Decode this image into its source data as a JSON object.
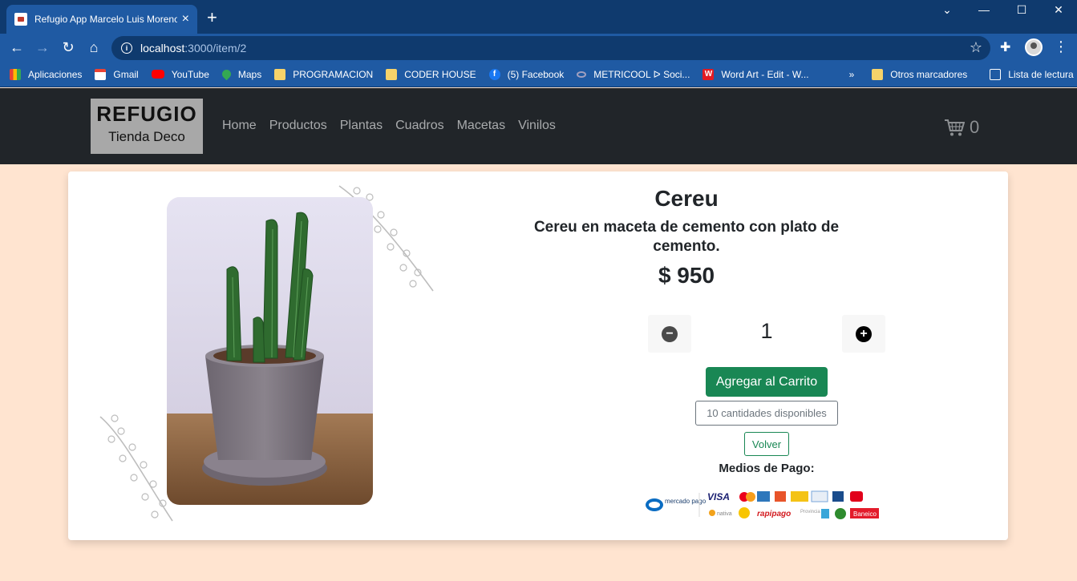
{
  "browser": {
    "tab_title": "Refugio App Marcelo Luis Moreno",
    "url_host": "localhost",
    "url_path": ":3000/item/2",
    "bookmarks": [
      {
        "label": "Aplicaciones",
        "icon": "apps-icon"
      },
      {
        "label": "Gmail",
        "icon": "gmail-icon"
      },
      {
        "label": "YouTube",
        "icon": "youtube-icon"
      },
      {
        "label": "Maps",
        "icon": "maps-icon"
      },
      {
        "label": "PROGRAMACION",
        "icon": "folder-icon"
      },
      {
        "label": "CODER HOUSE",
        "icon": "folder-icon"
      },
      {
        "label": "(5) Facebook",
        "icon": "facebook-icon"
      },
      {
        "label": "METRICOOL ᐅ Soci...",
        "icon": "metricool-icon"
      },
      {
        "label": "Word Art - Edit - W...",
        "icon": "wordart-icon"
      }
    ],
    "overflow": "»",
    "other_bookmarks": "Otros marcadores",
    "reading_list": "Lista de lectura"
  },
  "site": {
    "logo_main": "REFUGIO",
    "logo_sub": "Tienda Deco",
    "nav": [
      "Home",
      "Productos",
      "Plantas",
      "Cuadros",
      "Macetas",
      "Vinilos"
    ],
    "cart_count": "0"
  },
  "product": {
    "title": "Cereu",
    "description": "Cereu en maceta de cemento con plato de cemento.",
    "price": "$ 950",
    "quantity": "1",
    "add_to_cart": "Agregar al Carrito",
    "stock": "10 cantidades disponibles",
    "back": "Volver",
    "payment_title": "Medios de Pago:"
  },
  "payment_logos": {
    "mercadopago": "mercado pago",
    "visa": "VISA",
    "rapipago": "rapipago",
    "baneico": "Baneico"
  },
  "colors": {
    "page_bg": "#ffe4d0",
    "navbar_bg": "#212529",
    "success": "#198754",
    "chrome_blue": "#1f5aa3"
  }
}
